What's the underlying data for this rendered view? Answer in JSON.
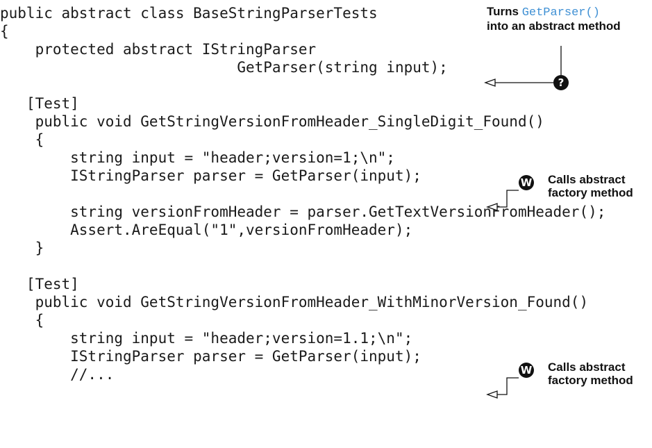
{
  "code": {
    "lines": [
      "public abstract class BaseStringParserTests",
      "{",
      "    protected abstract IStringParser",
      "                           GetParser(string input);",
      "",
      "   [Test]",
      "    public void GetStringVersionFromHeader_SingleDigit_Found()",
      "    {",
      "        string input = \"header;version=1;\\n\";",
      "        IStringParser parser = GetParser(input);",
      "",
      "        string versionFromHeader = parser.GetTextVersionFromHeader();",
      "        Assert.AreEqual(\"1\",versionFromHeader);",
      "    }",
      "",
      "   [Test]",
      "    public void GetStringVersionFromHeader_WithMinorVersion_Found()",
      "    {",
      "        string input = \"header;version=1.1;\\n\";",
      "        IStringParser parser = GetParser(input);",
      "        //..."
    ]
  },
  "annotations": {
    "a1": {
      "prefix": "Turns ",
      "code": "GetParser()",
      "line2": "into an abstract method",
      "marker": "?"
    },
    "a2": {
      "line1": "Calls abstract",
      "line2": "factory method",
      "marker": "W"
    },
    "a3": {
      "line1": "Calls abstract",
      "line2": "factory method",
      "marker": "W"
    }
  }
}
